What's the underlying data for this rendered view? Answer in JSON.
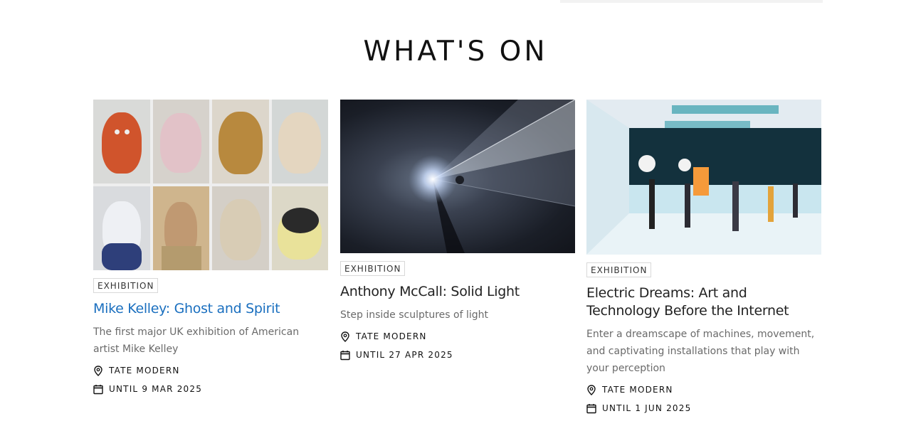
{
  "section": {
    "title": "WHAT'S ON"
  },
  "cards": [
    {
      "image_alt": "Mike Kelley stuffed toy portraits",
      "tag": "EXHIBITION",
      "title": "Mike Kelley: Ghost and Spirit",
      "description": "The first major UK exhibition of American artist Mike Kelley",
      "location": "TATE MODERN",
      "date": "UNTIL 9 MAR 2025",
      "location_icon": "map-pin-icon",
      "date_icon": "calendar-icon"
    },
    {
      "image_alt": "Solid light sculpture",
      "tag": "EXHIBITION",
      "title": "Anthony McCall: Solid Light",
      "description": "Step inside sculptures of light",
      "location": "TATE MODERN",
      "date": "UNTIL 27 APR 2025",
      "location_icon": "map-pin-icon",
      "date_icon": "calendar-icon"
    },
    {
      "image_alt": "Electric Dreams installation",
      "tag": "EXHIBITION",
      "title": "Electric Dreams: Art and Technology Before the Internet",
      "description": "Enter a dreamscape of machines, movement, and captivating installations that play with your perception",
      "location": "TATE MODERN",
      "date": "UNTIL 1 JUN 2025",
      "location_icon": "map-pin-icon",
      "date_icon": "calendar-icon"
    }
  ],
  "colors": {
    "link": "#1a6fbf",
    "text": "#222222",
    "muted": "#6a6a6a"
  }
}
